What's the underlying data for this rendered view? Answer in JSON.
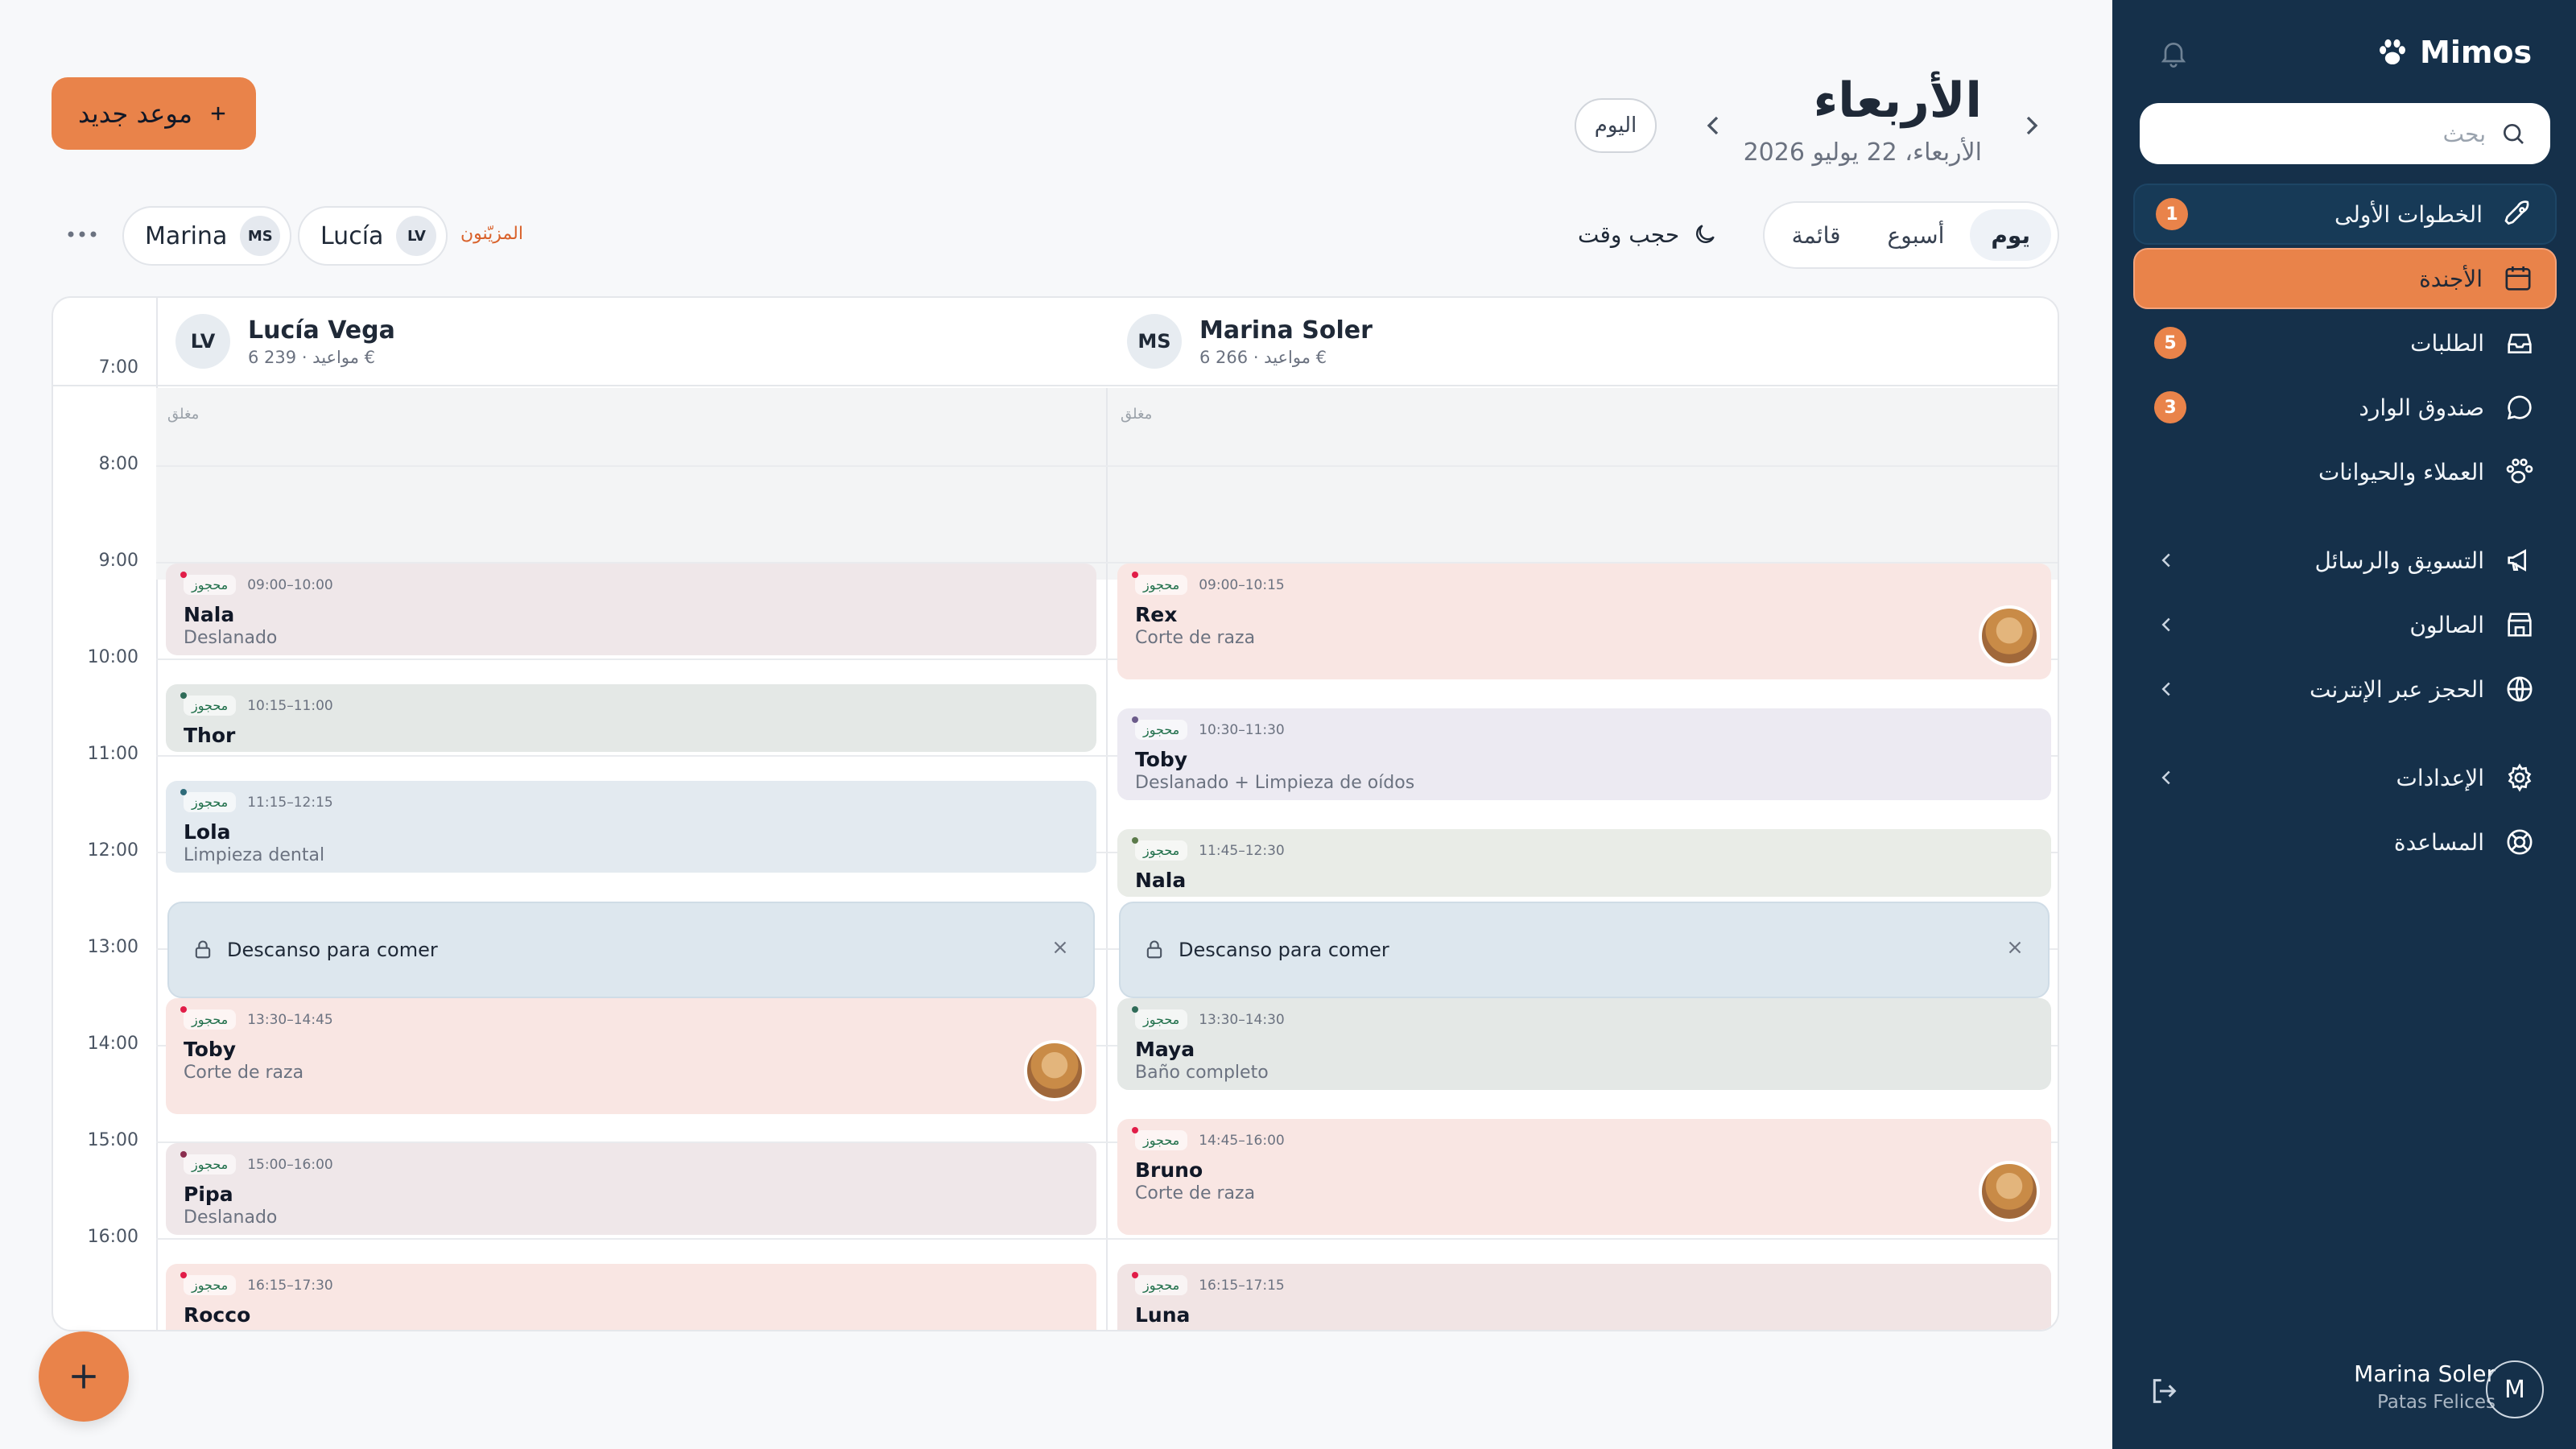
{
  "brand": {
    "name": "Mimos"
  },
  "search": {
    "placeholder": "بحث"
  },
  "nav": {
    "getting_started": {
      "label": "الخطوات الأولى",
      "badge": "1"
    },
    "agenda": {
      "label": "الأجندة"
    },
    "orders": {
      "label": "الطلبات",
      "badge": "5"
    },
    "inbox": {
      "label": "صندوق الوارد",
      "badge": "3"
    },
    "clients": {
      "label": "العملاء والحيوانات"
    },
    "marketing": {
      "label": "التسويق والرسائل"
    },
    "salon": {
      "label": "الصالون"
    },
    "online": {
      "label": "الحجز عبر الإنترنت"
    },
    "settings": {
      "label": "الإعدادات"
    },
    "help": {
      "label": "المساعدة"
    }
  },
  "user": {
    "name": "Marina Soler",
    "business": "Patas Felices",
    "initial": "M"
  },
  "header": {
    "title": "الأربعاء",
    "date": "الأربعاء، 22 يوليو 2026",
    "today": "اليوم",
    "new_appointment": "موعد جديد"
  },
  "views": {
    "day": "يوم",
    "week": "أسبوع",
    "list": "قائمة"
  },
  "block_time": "حجب وقت",
  "staff_filter": {
    "label": "المزيّنون",
    "chips": [
      {
        "name": "Lucía",
        "initials": "LV"
      },
      {
        "name": "Marina",
        "initials": "MS"
      }
    ]
  },
  "hours": [
    "7:00",
    "8:00",
    "9:00",
    "10:00",
    "11:00",
    "12:00",
    "13:00",
    "14:00",
    "15:00",
    "16:00"
  ],
  "closed_label": "مغلق",
  "booked_label": "محجوز",
  "lunch_label": "Descanso para comer",
  "columns": [
    {
      "name": "Lucía Vega",
      "initials": "LV",
      "stats": "6 مواعيد · 239 €",
      "appointments": [
        {
          "time": "09:00–10:00",
          "pet": "Nala",
          "service": "Deslanado",
          "color": "c-mauve",
          "dot": "#e11d48"
        },
        {
          "time": "10:15–11:00",
          "pet": "Thor",
          "service": "",
          "color": "c-mint",
          "dot": "#2f6b58"
        },
        {
          "time": "11:15–12:15",
          "pet": "Lola",
          "service": "Limpieza dental",
          "color": "c-blue",
          "dot": "#2f6b7a"
        },
        {
          "time": "13:30–14:45",
          "pet": "Toby",
          "service": "Corte de raza",
          "color": "c-pink",
          "dot": "#e11d48"
        },
        {
          "time": "15:00–16:00",
          "pet": "Pipa",
          "service": "Deslanado",
          "color": "c-mauve",
          "dot": "#8b2e4f"
        },
        {
          "time": "16:15–17:30",
          "pet": "Rocco",
          "service": "",
          "color": "c-pink",
          "dot": "#e11d48"
        }
      ]
    },
    {
      "name": "Marina Soler",
      "initials": "MS",
      "stats": "6 مواعيد · 266 €",
      "appointments": [
        {
          "time": "09:00–10:15",
          "pet": "Rex",
          "service": "Corte de raza",
          "color": "c-pink",
          "dot": "#e11d48"
        },
        {
          "time": "10:30–11:30",
          "pet": "Toby",
          "service": "Deslanado + Limpieza de oídos",
          "color": "c-lav",
          "dot": "#6b5b8a"
        },
        {
          "time": "11:45–12:30",
          "pet": "Nala",
          "service": "",
          "color": "c-sage",
          "dot": "#5b7a4a"
        },
        {
          "time": "13:30–14:30",
          "pet": "Maya",
          "service": "Baño completo",
          "color": "c-mint",
          "dot": "#2f6b58"
        },
        {
          "time": "14:45–16:00",
          "pet": "Bruno",
          "service": "Corte de raza",
          "color": "c-pink",
          "dot": "#e11d48"
        },
        {
          "time": "16:15–17:15",
          "pet": "Luna",
          "service": "",
          "color": "c-rose",
          "dot": "#e11d48"
        }
      ]
    }
  ],
  "colors": {
    "accent": "#e9834a",
    "sidebar": "#15304a",
    "background": "#f7f8fa"
  }
}
